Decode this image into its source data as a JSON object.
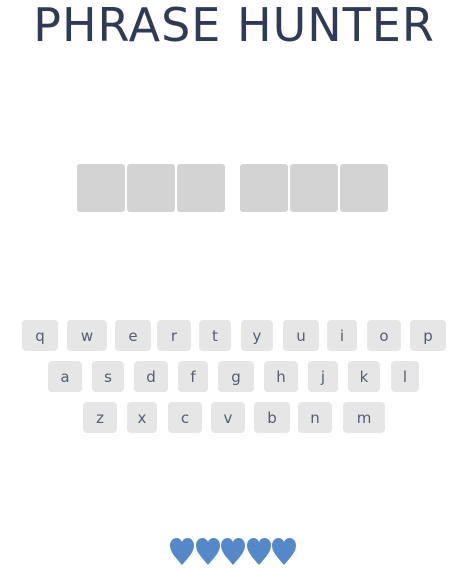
{
  "title": "PHRASE HUNTER",
  "phrase": {
    "words": [
      3,
      3
    ]
  },
  "keyboard": {
    "rows": [
      [
        "q",
        "w",
        "e",
        "r",
        "t",
        "y",
        "u",
        "i",
        "o",
        "p"
      ],
      [
        "a",
        "s",
        "d",
        "f",
        "g",
        "h",
        "j",
        "k",
        "l"
      ],
      [
        "z",
        "x",
        "c",
        "v",
        "b",
        "n",
        "m"
      ]
    ]
  },
  "lives": {
    "remaining": 5,
    "total": 5,
    "icon": "heart-icon",
    "color": "#5588c8"
  },
  "colors": {
    "title": "#2e3a56",
    "letter_box": "#d3d3d3",
    "key_bg": "#e6e6e6",
    "key_text": "#555d6e"
  }
}
